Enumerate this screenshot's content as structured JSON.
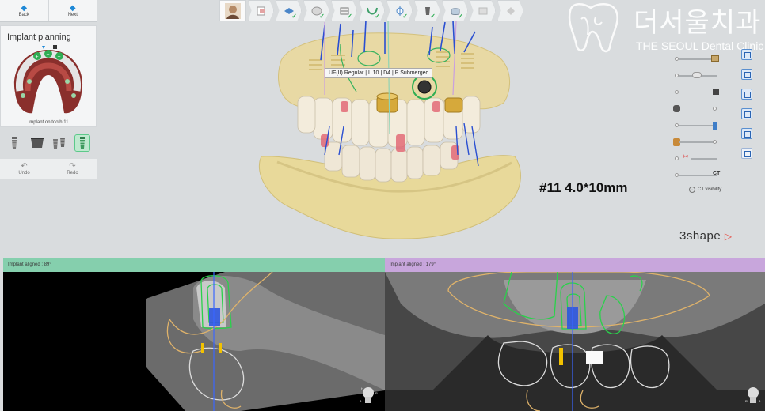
{
  "nav": {
    "back_label": "Back",
    "next_label": "Next"
  },
  "plan_panel": {
    "title": "Implant planning",
    "caption": "Implant on tooth 11"
  },
  "tools": [
    "implant-icon",
    "abutment-icon",
    "multi-implant-icon",
    "implant-selected-icon"
  ],
  "history": {
    "undo_label": "Undo",
    "redo_label": "Redo"
  },
  "workflow": {
    "steps": [
      {
        "icon": "patient-icon",
        "done": false
      },
      {
        "icon": "documents-icon",
        "done": false
      },
      {
        "icon": "ct-scan-icon",
        "done": true
      },
      {
        "icon": "tooth-icon",
        "done": true
      },
      {
        "icon": "cross-section-icon",
        "done": true
      },
      {
        "icon": "arch-curve-icon",
        "done": true
      },
      {
        "icon": "alignment-icon",
        "done": true
      },
      {
        "icon": "implant-step-icon",
        "done": true
      },
      {
        "icon": "sleeve-icon",
        "done": true
      },
      {
        "icon": "guide-design-icon",
        "done": false
      },
      {
        "icon": "export-icon",
        "done": false
      }
    ]
  },
  "brand": {
    "korean": "더서울치과",
    "english": "THE SEOUL Dental Clinic"
  },
  "tooltip": "UF(II) Regular | L 10 | D4 | P Submerged",
  "overlay": "#11 4.0*10mm",
  "vendor": {
    "name": "3shape",
    "mark": "▷"
  },
  "ct_visibility_label": "CT visibility",
  "panels": {
    "left": {
      "header": "Implant aligned : 89°",
      "color": "#85cfad"
    },
    "right": {
      "header": "Implant aligned : 179°",
      "color": "#c8a6dc"
    }
  },
  "colors": {
    "accent": "#1e88d6",
    "check": "#2fae54",
    "vendor_mark": "#e8433a"
  }
}
